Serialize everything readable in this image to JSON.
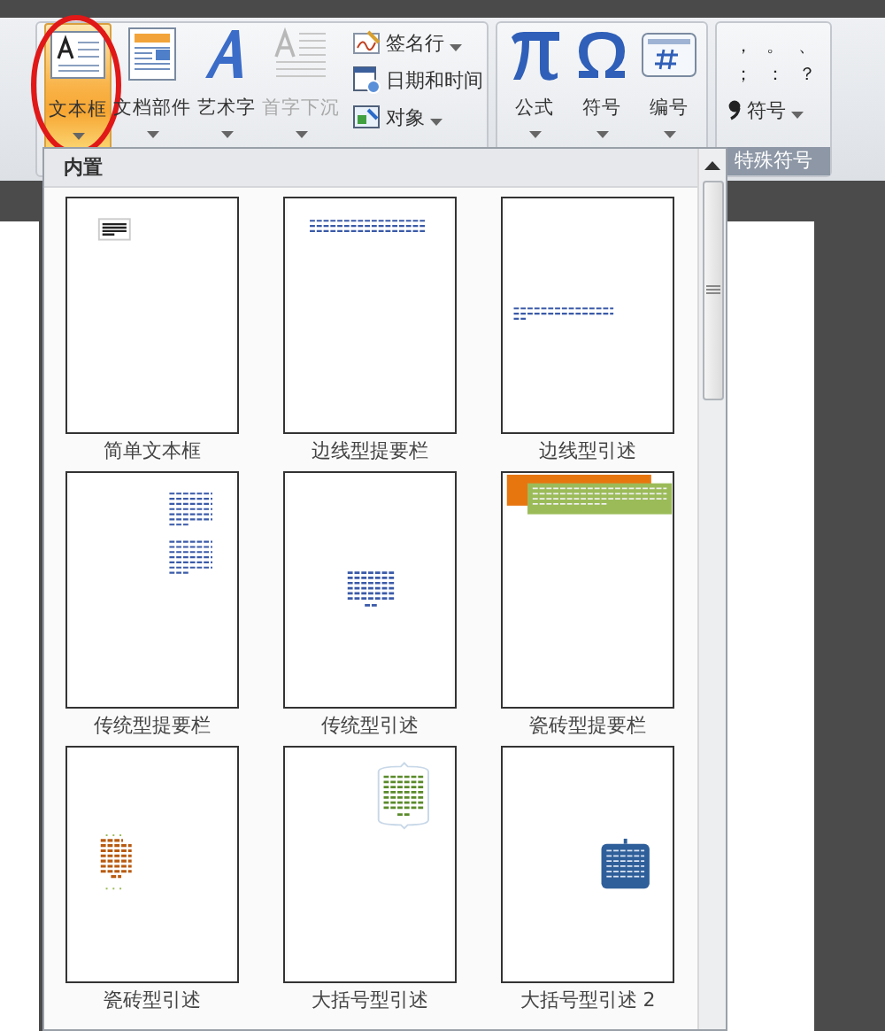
{
  "ribbon": {
    "groups": [
      {
        "kind": "insert-text",
        "buttons": [
          {
            "label": "文本框",
            "kind": "textbox",
            "pressed": true,
            "annotated": true,
            "disabled": false
          },
          {
            "label": "文档部件",
            "kind": "parts",
            "pressed": false,
            "annotated": false,
            "disabled": false
          },
          {
            "label": "艺术字",
            "kind": "wordart",
            "pressed": false,
            "annotated": false,
            "disabled": false
          },
          {
            "label": "首字下沉",
            "kind": "dropcap",
            "pressed": false,
            "annotated": false,
            "disabled": true
          }
        ],
        "small_buttons": [
          {
            "label": "签名行",
            "kind": "signature",
            "dropdown": true
          },
          {
            "label": "日期和时间",
            "kind": "calendar",
            "dropdown": false
          },
          {
            "label": "对象",
            "kind": "object",
            "dropdown": true
          }
        ]
      },
      {
        "kind": "symbols",
        "buttons": [
          {
            "label": "公式",
            "kind": "pi",
            "pressed": false,
            "annotated": false,
            "disabled": false
          },
          {
            "label": "符号",
            "kind": "omega",
            "pressed": false,
            "annotated": false,
            "disabled": false
          },
          {
            "label": "编号",
            "kind": "number",
            "pressed": false,
            "annotated": false,
            "disabled": false
          }
        ]
      },
      {
        "kind": "special",
        "symbols": [
          "，",
          "。",
          "、",
          "；",
          "：",
          "？"
        ],
        "menu_label": "符号",
        "title": "特殊符号"
      }
    ]
  },
  "gallery": {
    "header": "内置",
    "items": [
      {
        "label": "简单文本框",
        "kind": "simple"
      },
      {
        "label": "边线型提要栏",
        "kind": "top-lines"
      },
      {
        "label": "边线型引述",
        "kind": "mid-lines"
      },
      {
        "label": "传统型提要栏",
        "kind": "right-column"
      },
      {
        "label": "传统型引述",
        "kind": "center-block"
      },
      {
        "label": "瓷砖型提要栏",
        "kind": "tile-bar"
      },
      {
        "label": "瓷砖型引述",
        "kind": "tile-quote"
      },
      {
        "label": "大括号型引述",
        "kind": "brace-quote"
      },
      {
        "label": "大括号型引述 2",
        "kind": "brace-quote-2"
      }
    ]
  }
}
